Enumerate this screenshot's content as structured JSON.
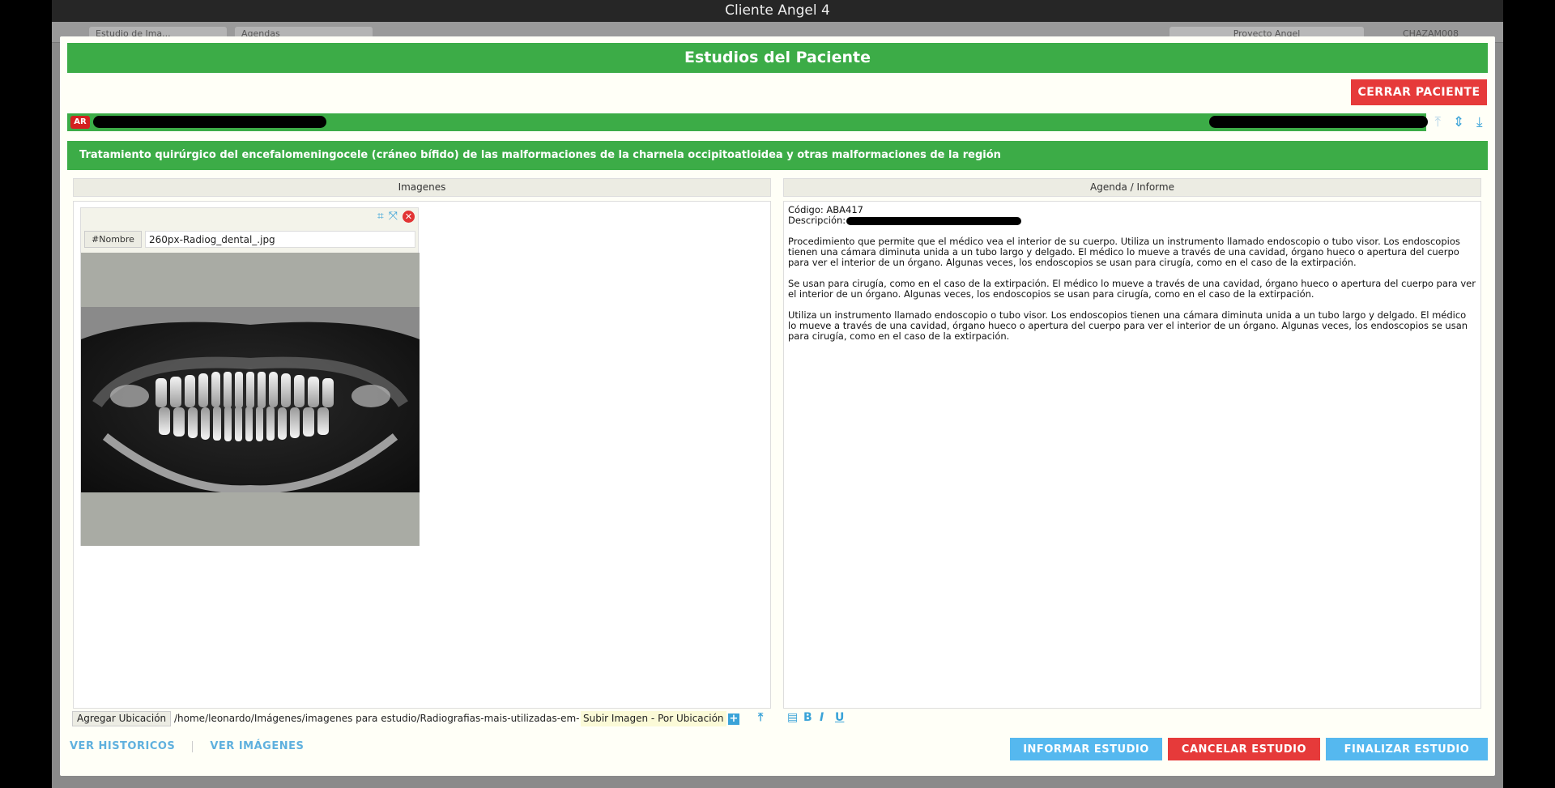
{
  "window": {
    "title": "Cliente Angel 4"
  },
  "background": {
    "tabs": [
      "Estudio de Ima...",
      "Agendas"
    ],
    "search_label": "Proyecto Angel",
    "user_label": "CHAZAM008"
  },
  "modal": {
    "title": "Estudios del Paciente",
    "close_patient_label": "CERRAR PACIENTE",
    "country_badge": "AR",
    "study_title": "Tratamiento quirúrgico del encefalomeningocele (cráneo bífido) de las malformaciones de la charnela occipitoatloidea y otras malformaciones de la región",
    "images_panel": {
      "header": "Imagenes",
      "card": {
        "name_tag": "#Nombre",
        "name_value": "260px-Radiog_dental_.jpg",
        "image_description_icon": "dental-xray"
      },
      "add_location_label": "Agregar Ubicación",
      "path_value": "/home/leonardo/Imágenes/imagenes para estudio/Radiografias-mais-utilizadas-em-odont",
      "upload_label": "Subir Imagen - Por Ubicación"
    },
    "report_panel": {
      "header": "Agenda / Informe",
      "code_line": "Código: ABA417",
      "description_label": "Descripción:",
      "paragraphs": [
        "Procedimiento que permite que el médico vea el interior de su cuerpo. Utiliza un instrumento llamado endoscopio o tubo visor. Los endoscopios tienen una cámara diminuta unida a un tubo largo y delgado. El médico lo mueve a través de una cavidad, órgano hueco o apertura del cuerpo para ver el interior de un órgano. Algunas veces, los endoscopios se usan para cirugía, como en el caso de la extirpación.",
        "Se usan para cirugía, como en el caso de la extirpación. El médico lo mueve a través de una cavidad, órgano hueco o apertura del cuerpo para ver el interior de un órgano. Algunas veces, los endoscopios se usan para cirugía, como en el caso de la extirpación.",
        "Utiliza un instrumento llamado endoscopio o tubo visor. Los endoscopios tienen una cámara diminuta unida a un tubo largo y delgado. El médico lo mueve a través de una cavidad, órgano hueco o apertura del cuerpo para ver el interior de un órgano. Algunas veces, los endoscopios se usan para cirugía, como en el caso de la extirpación."
      ],
      "toolbar": {
        "bold": "B",
        "italic": "I",
        "underline": "U"
      }
    },
    "footer": {
      "ver_historicos": "VER HISTORICOS",
      "ver_imagenes": "VER IMÁGENES",
      "informar": "INFORMAR ESTUDIO",
      "cancelar": "CANCELAR ESTUDIO",
      "finalizar": "FINALIZAR ESTUDIO"
    },
    "colors": {
      "green": "#3cac47",
      "red": "#e63a3a",
      "blue": "#55b8ef"
    }
  }
}
